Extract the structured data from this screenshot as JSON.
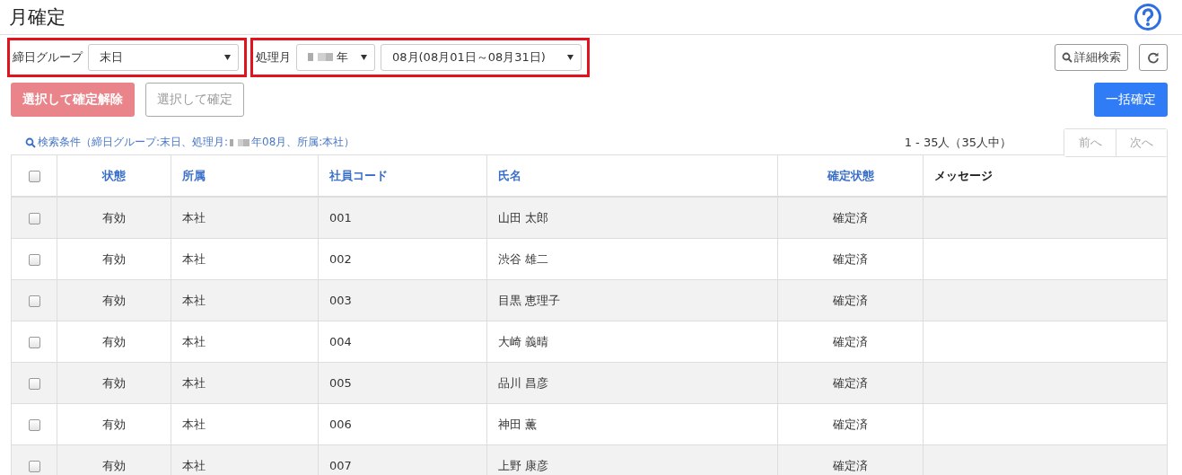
{
  "page_title": "月確定",
  "filters": {
    "closing_group": {
      "label": "締日グループ",
      "value": "末日"
    },
    "period": {
      "label": "処理月",
      "year": "年",
      "month": "08月(08月01日～08月31日)"
    }
  },
  "toolbar": {
    "detail_search": "詳細検索"
  },
  "actions": [
    {
      "label": "選択して確定解除",
      "kind": "danger"
    },
    {
      "label": "選択して確定",
      "kind": "outline"
    },
    {
      "label": "一括確定",
      "kind": "primary"
    }
  ],
  "search_condition": {
    "before": "検索条件（締日グループ:末日、処理月:",
    "after": "年08月、所属:本社）"
  },
  "pagination": {
    "summary": "1 - 35人（35人中）",
    "prev": "前へ",
    "next": "次へ"
  },
  "table": {
    "header_checked": false,
    "columns": [
      "状態",
      "所属",
      "社員コード",
      "氏名",
      "確定状態",
      "メッセージ"
    ],
    "rows": [
      {
        "checked": false,
        "cells": [
          "有効",
          "本社",
          "001",
          "山田 太郎",
          "確定済",
          ""
        ]
      },
      {
        "checked": false,
        "cells": [
          "有効",
          "本社",
          "002",
          "渋谷 雄二",
          "確定済",
          ""
        ]
      },
      {
        "checked": false,
        "cells": [
          "有効",
          "本社",
          "003",
          "目黒 恵理子",
          "確定済",
          ""
        ]
      },
      {
        "checked": false,
        "cells": [
          "有効",
          "本社",
          "004",
          "大崎 義晴",
          "確定済",
          ""
        ]
      },
      {
        "checked": false,
        "cells": [
          "有効",
          "本社",
          "005",
          "品川 昌彦",
          "確定済",
          ""
        ]
      },
      {
        "checked": false,
        "cells": [
          "有効",
          "本社",
          "006",
          "神田 薫",
          "確定済",
          ""
        ]
      },
      {
        "checked": false,
        "cells": [
          "有効",
          "本社",
          "007",
          "上野 康彦",
          "確定済",
          ""
        ]
      }
    ]
  }
}
